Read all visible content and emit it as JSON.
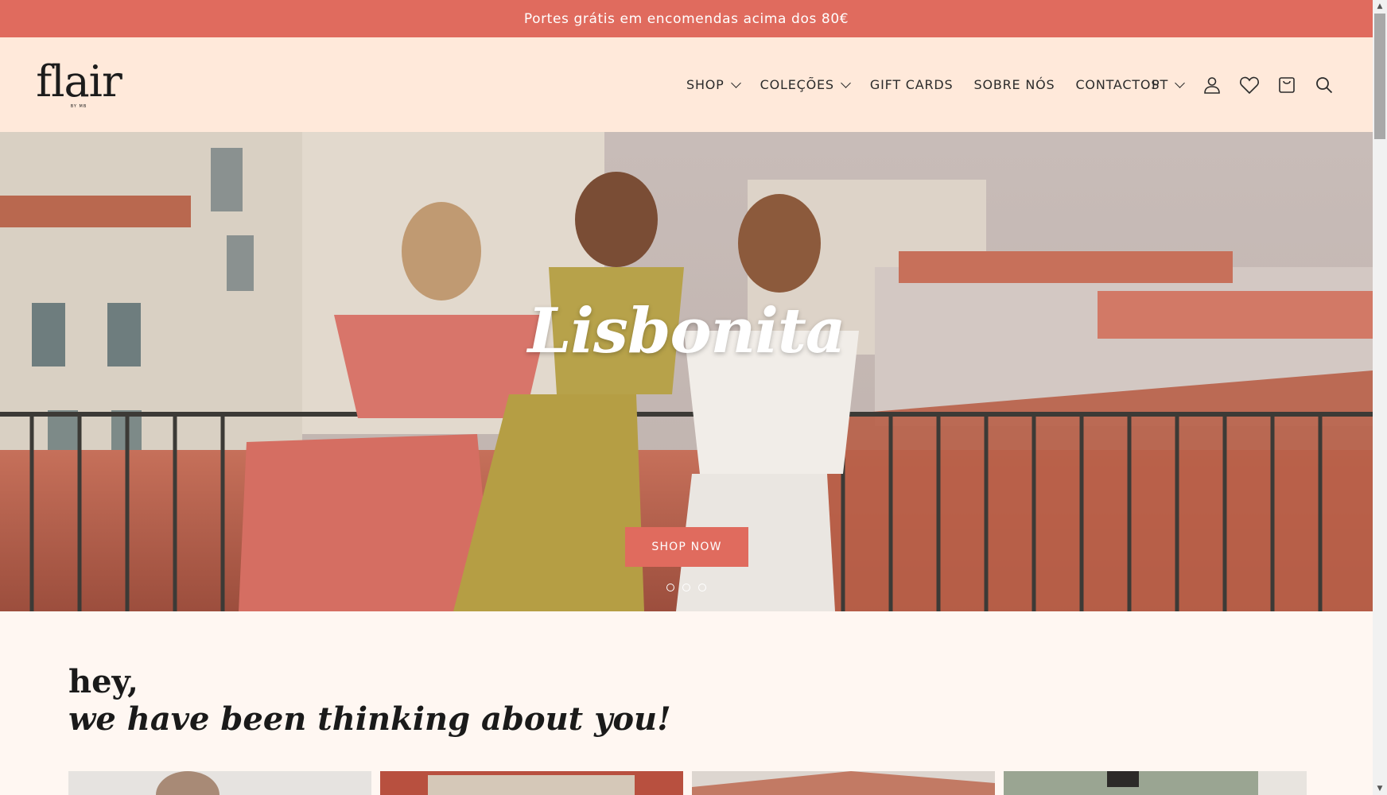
{
  "announcement": {
    "text": "Portes grátis em encomendas acima dos 80€"
  },
  "header": {
    "logo_word": "flair",
    "logo_sub": "BY MB",
    "nav": [
      {
        "label": "SHOP",
        "has_dropdown": true
      },
      {
        "label": "COLEÇÕES",
        "has_dropdown": true
      },
      {
        "label": "GIFT CARDS",
        "has_dropdown": false
      },
      {
        "label": "SOBRE NÓS",
        "has_dropdown": false
      },
      {
        "label": "CONTACTOS",
        "has_dropdown": false
      }
    ],
    "language": "PT",
    "icons": [
      "account-icon",
      "wishlist-heart-icon",
      "cart-bag-icon",
      "search-icon"
    ]
  },
  "hero": {
    "title": "Lisbonita",
    "button_label": "SHOP NOW",
    "slide_count": 3
  },
  "intro": {
    "line1": "hey,",
    "line2": "we have been thinking about you!"
  },
  "colors": {
    "accent": "#e06b5e",
    "header_bg": "#ffe9da",
    "page_bg": "#fff7f2",
    "text_dark": "#1a1a1a"
  }
}
